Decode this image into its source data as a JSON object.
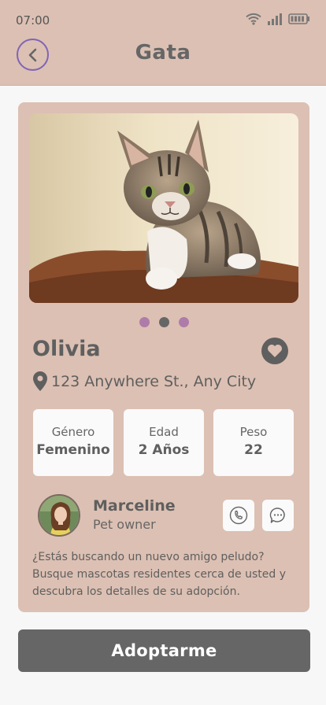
{
  "status_bar": {
    "time": "07:00"
  },
  "header": {
    "title": "Gata"
  },
  "pet": {
    "name": "Olivia",
    "address": "123 Anywhere St., Any City",
    "photo_index": 2,
    "photo_count": 3
  },
  "stats": [
    {
      "label": "Género",
      "value": "Femenino"
    },
    {
      "label": "Edad",
      "value": "2 Años"
    },
    {
      "label": "Peso",
      "value": "22"
    }
  ],
  "owner": {
    "name": "Marceline",
    "role": "Pet owner"
  },
  "description": "¿Estás buscando un nuevo amigo peludo? Busque mascotas residentes cerca de usted y descubra los detalles de su adopción.",
  "cta": {
    "label": "Adoptarme"
  },
  "colors": {
    "background": "#f7f7f7",
    "accent": "#dcc0b3",
    "dot": "#ae7ca9",
    "back_ring": "#7f64b8",
    "button": "#666666"
  },
  "icons": {
    "status": [
      "wifi-icon",
      "signal-icon",
      "battery-icon"
    ],
    "back": "chevron-left-icon",
    "favorite": "heart-icon",
    "location": "map-pin-icon",
    "call": "phone-icon",
    "chat": "chat-bubble-icon"
  }
}
